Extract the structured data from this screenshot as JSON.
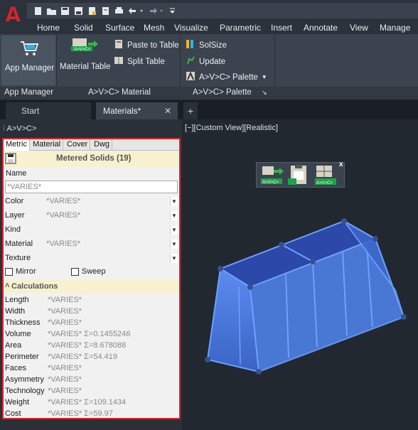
{
  "qat": {
    "icons": [
      "new-icon",
      "open-icon",
      "save-icon",
      "save-as-icon",
      "publish-icon",
      "plot-icon",
      "print-icon",
      "undo-icon",
      "redo-icon",
      "customize-icon"
    ]
  },
  "ribbon_tabs": [
    "Home",
    "Solid",
    "Surface",
    "Mesh",
    "Visualize",
    "Parametric",
    "Insert",
    "Annotate",
    "View",
    "Manage"
  ],
  "ribbon": {
    "app_manager": {
      "line1": "App",
      "line2": "Manager"
    },
    "app_manager_panel": "App Manager",
    "material_table": "Material Table",
    "paste_to_table": "Paste to Table",
    "split_table": "Split Table",
    "material_panel": "A>V>C> Material",
    "solsize": "SolSize",
    "update": "Update",
    "avc_palette": "A>V>C> Palette",
    "palette_panel": "A>V>C> Palette",
    "icon_label": "A>V>C>"
  },
  "doc_tabs": {
    "start": "Start",
    "active": "Materials*",
    "close": "✕",
    "add": "+"
  },
  "side_panel": {
    "title": "A>V>C>",
    "tabs": [
      "Metric",
      "Material",
      "Cover",
      "Dwg"
    ],
    "header": "Metered Solids (19)",
    "name_label": "Name",
    "name_value": "*VARIES*",
    "fields": [
      {
        "label": "Color",
        "value": "*VARIES*"
      },
      {
        "label": "Layer",
        "value": "*VARIES*"
      },
      {
        "label": "Kind",
        "value": ""
      },
      {
        "label": "Material",
        "value": "*VARIES*"
      },
      {
        "label": "Texture",
        "value": ""
      }
    ],
    "mirror": "Mirror",
    "sweep": "Sweep",
    "calc_header": "Calculations",
    "calc": [
      {
        "label": "Length",
        "value": "*VARIES*"
      },
      {
        "label": "Width",
        "value": "*VARIES*"
      },
      {
        "label": "Thickness",
        "value": "*VARIES*"
      },
      {
        "label": "Volume",
        "value": "*VARIES* Σ=0.1455246"
      },
      {
        "label": "Area",
        "value": "*VARIES* Σ=8.678088"
      },
      {
        "label": "Perimeter",
        "value": "*VARIES* Σ=54.419"
      },
      {
        "label": "Faces",
        "value": "*VARIES*"
      },
      {
        "label": "Asymmetry",
        "value": "*VARIES*"
      },
      {
        "label": "Technology",
        "value": "*VARIES*"
      },
      {
        "label": "Weight",
        "value": "*VARIES* Σ=109.1434"
      },
      {
        "label": "Cost",
        "value": "*VARIES* Σ=59.97"
      }
    ]
  },
  "viewport": {
    "label": "[−][Custom View][Realistic]",
    "toolbar_close": "x"
  },
  "colors": {
    "accent_red": "#d9232a",
    "solid_blue": "#4a78d8",
    "ribbon_bg": "#3b434e"
  }
}
